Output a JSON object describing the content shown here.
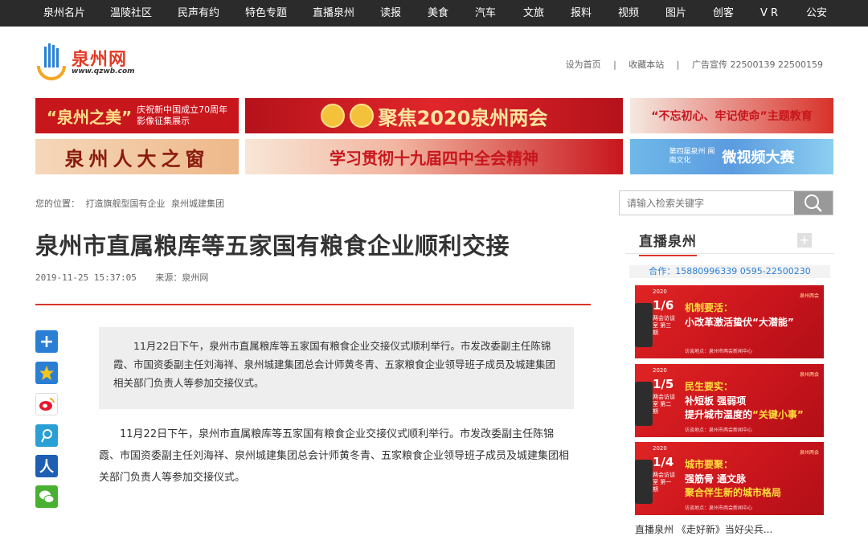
{
  "nav": [
    "泉州名片",
    "温陵社区",
    "民声有约",
    "特色专题",
    "直播泉州",
    "读报",
    "美食",
    "汽车",
    "文旅",
    "报料",
    "视频",
    "图片",
    "创客",
    "V R",
    "公安"
  ],
  "logo": {
    "name": "泉州网",
    "url": "www.qzwb.com"
  },
  "toplinks": {
    "home": "设为首页",
    "sep": "|",
    "bookmark": "收藏本站",
    "ad": "广告宣传 22500139 22500159"
  },
  "banners": {
    "b1_big": "“泉州之美”",
    "b1_sub1": "庆祝新中国成立70周年",
    "b1_sub2": "影像征集展示",
    "b2": "聚焦2020泉州两会",
    "b3": "“不忘初心、牢记使命”主题教育",
    "b4": "泉州人大之窗",
    "b5": "学习贯彻十九届四中全会精神",
    "b6_small": "第四届泉州 闽南文化",
    "b6": "微视频大赛"
  },
  "breadcrumb": {
    "label": "您的位置：",
    "item1": "打造旗舰型国有企业",
    "item2": "泉州城建集团"
  },
  "search": {
    "placeholder": "请输入检索关键字"
  },
  "article": {
    "title": "泉州市直属粮库等五家国有粮食企业顺利交接",
    "time": "2019-11-25 15:37:05",
    "source": "来源：泉州网",
    "summary": "11月22日下午，泉州市直属粮库等五家国有粮食企业交接仪式顺利举行。市发改委副主任陈锦霞、市国资委副主任刘海祥、泉州城建集团总会计师黄冬青、五家粮食企业领导班子成员及城建集团相关部门负责人等参加交接仪式。",
    "body": "11月22日下午，泉州市直属粮库等五家国有粮食企业交接仪式顺利举行。市发改委副主任陈锦霞、市国资委副主任刘海祥、泉州城建集团总会计师黄冬青、五家粮食企业领导班子成员及城建集团相关部门负责人等参加交接仪式。"
  },
  "share_icons": [
    "plus-share-icon",
    "qzone-icon",
    "weibo-icon",
    "tencent-weibo-icon",
    "renren-icon",
    "wechat-icon"
  ],
  "sidebar": {
    "heading": "直播泉州",
    "plus": "+",
    "coop": "合作：15880996339 0595-22500230",
    "cards": [
      {
        "year": "2020",
        "date": "1/6",
        "room": "两会访谈室 第三期",
        "line1": "机制要活：",
        "line2": "小改革激活蛰伏“大潜能”",
        "foot": "访谈地点：泉州市两会新闻中心",
        "tag": "泉州两会"
      },
      {
        "year": "2020",
        "date": "1/5",
        "room": "两会访谈室 第二期",
        "line1": "民生要实：",
        "line2": "补短板 强弱项",
        "line3a": "提升城市温度的",
        "line3b": "“关键小事”",
        "foot": "访谈地点：泉州市两会新闻中心",
        "tag": "泉州两会"
      },
      {
        "year": "2020",
        "date": "1/4",
        "room": "两会访谈室 第一期",
        "line1": "城市要聚：",
        "line2": "强筋骨 通文脉",
        "line3a": "聚合伴生新的城市格局",
        "line3b": "",
        "foot": "访谈地点：泉州市两会新闻中心",
        "tag": "泉州两会"
      }
    ],
    "more": "直播泉州 《走好新》当好尖兵..."
  }
}
